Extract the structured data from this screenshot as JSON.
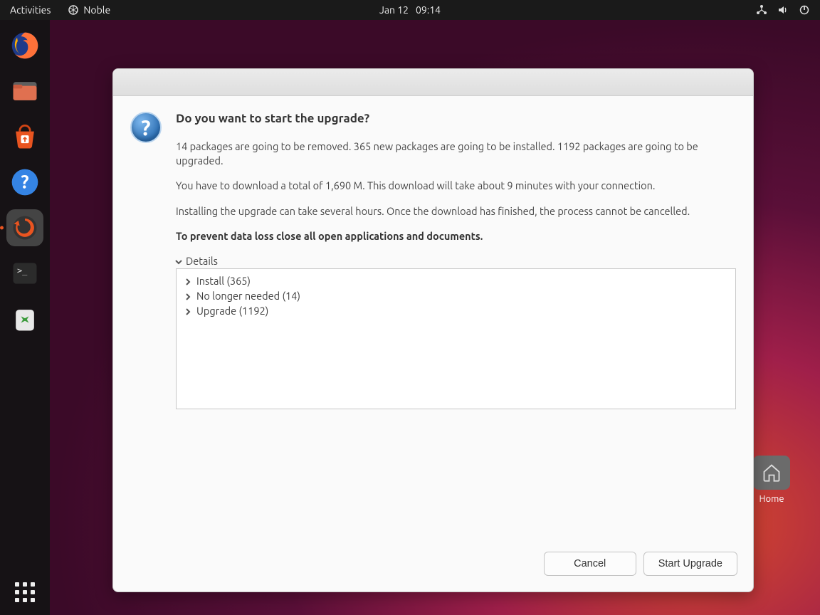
{
  "topbar": {
    "activities": "Activities",
    "app_name": "Noble",
    "date": "Jan 12",
    "time": "09:14"
  },
  "dock": {
    "items": [
      {
        "name": "firefox"
      },
      {
        "name": "files"
      },
      {
        "name": "software"
      },
      {
        "name": "help"
      },
      {
        "name": "updater"
      },
      {
        "name": "terminal"
      },
      {
        "name": "trash"
      }
    ]
  },
  "desktop": {
    "home_label": "Home"
  },
  "dialog": {
    "title": "Do you want to start the upgrade?",
    "p1": "14 packages are going to be removed. 365 new packages are going to be installed. 1192 packages are going to be upgraded.",
    "p2": "You have to download a total of 1,690 M. This download will take about 9 minutes with your connection.",
    "p3": "Installing the upgrade can take several hours. Once the download has finished, the process cannot be cancelled.",
    "p4": "To prevent data loss close all open applications and documents.",
    "details_label": "Details",
    "tree": [
      {
        "label": "Install (365)"
      },
      {
        "label": "No longer needed (14)"
      },
      {
        "label": "Upgrade (1192)"
      }
    ],
    "cancel": "Cancel",
    "start": "Start Upgrade"
  }
}
